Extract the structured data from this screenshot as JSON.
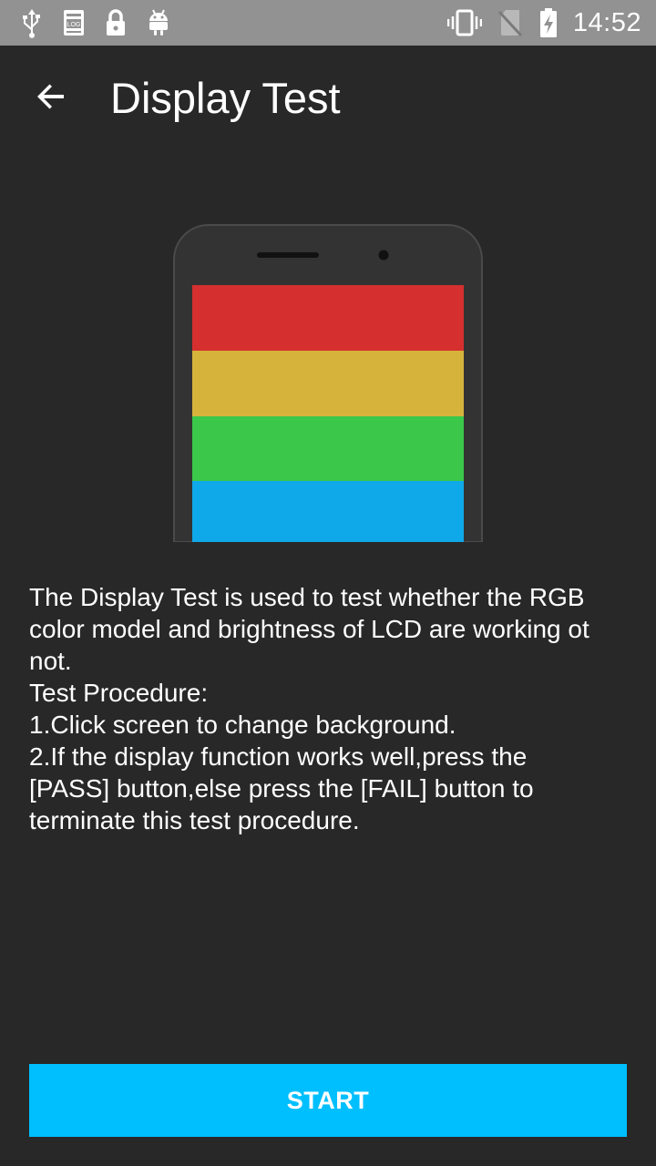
{
  "status_bar": {
    "time": "14:52",
    "left_icons": [
      "usb-icon",
      "debug-log-icon",
      "lock-icon",
      "android-icon"
    ],
    "right_icons": [
      "vibrate-icon",
      "no-sim-icon",
      "battery-charging-icon"
    ]
  },
  "app_bar": {
    "title": "Display Test",
    "back_icon": "arrow-back-icon"
  },
  "illustration": {
    "stripe_colors": [
      "#d62f2f",
      "#d6b33a",
      "#3bc84a",
      "#0fa8e8"
    ],
    "body_color": "#333333",
    "outline_color": "#4a4a4a"
  },
  "description": {
    "lines": [
      "The Display Test is used to test whether the RGB",
      "color model and brightness of LCD are working ot",
      "not.",
      "Test Procedure:",
      "1.Click screen to change background.",
      "2.If the display function works well,press the",
      "[PASS] button,else press the [FAIL] button to",
      "terminate this test procedure."
    ]
  },
  "start_button": {
    "label": "START",
    "color": "#00bfff"
  },
  "colors": {
    "background": "#282828",
    "status_bar": "#929292"
  }
}
